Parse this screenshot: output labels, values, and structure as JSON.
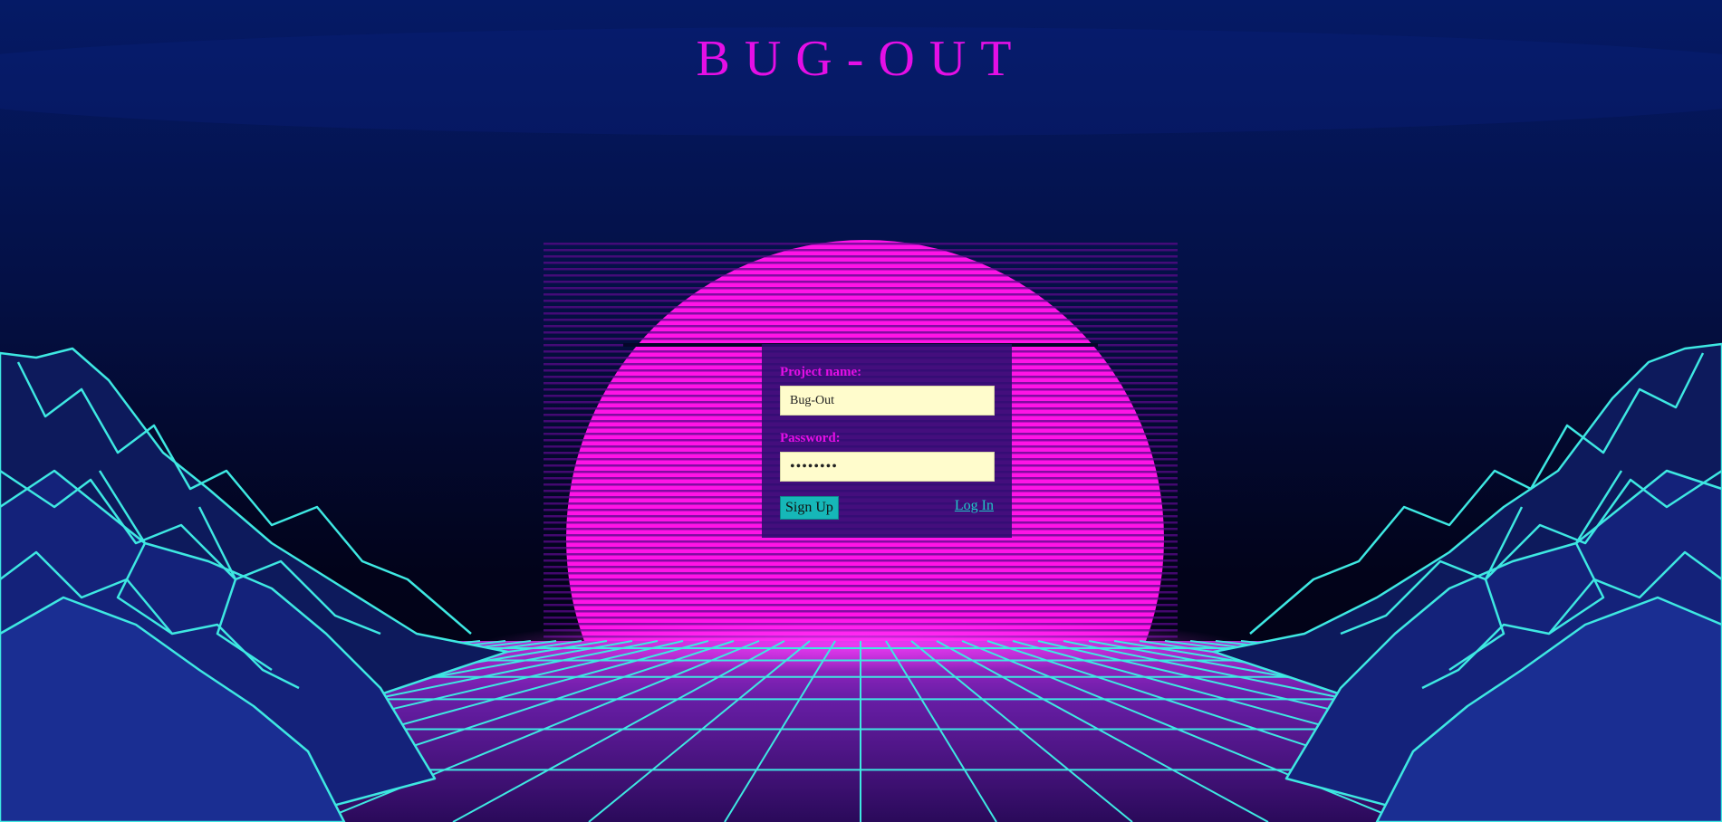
{
  "app": {
    "title": "BUG-OUT"
  },
  "login_form": {
    "project_name_label": "Project name:",
    "project_name_value": "Bug-Out",
    "password_label": "Password:",
    "password_value": "••••••••",
    "signup_label": "Sign Up",
    "login_label": "Log In"
  },
  "theme": {
    "accent": "#e40fe6",
    "sun": "#ff1aea",
    "grid": "#3ee8e2",
    "input_bg": "#fffccc",
    "button_bg": "#16b7b8",
    "panel_bg": "#2a0e6e"
  }
}
